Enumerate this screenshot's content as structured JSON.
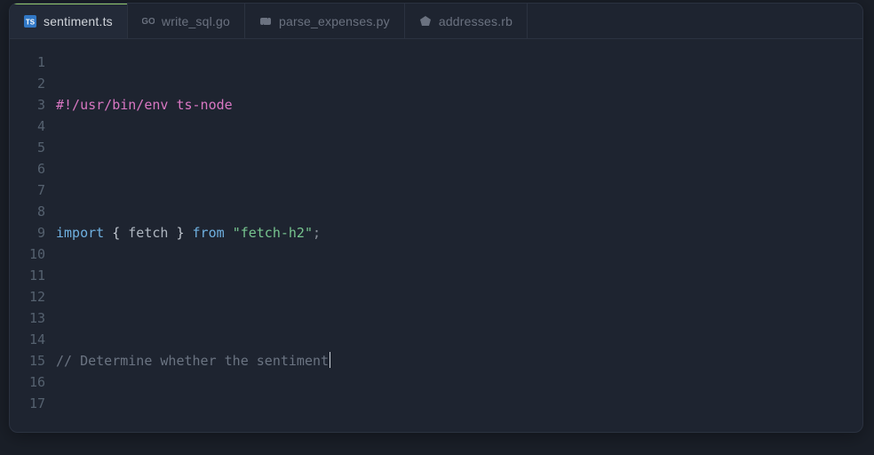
{
  "tabs": [
    {
      "label": "sentiment.ts",
      "icon": "ts-icon",
      "active": true
    },
    {
      "label": "write_sql.go",
      "icon": "go-icon",
      "active": false
    },
    {
      "label": "parse_expenses.py",
      "icon": "py-icon",
      "active": false
    },
    {
      "label": "addresses.rb",
      "icon": "rb-icon",
      "active": false
    }
  ],
  "gutter": {
    "start": 1,
    "end": 17
  },
  "code": {
    "line1": {
      "shebang": "#!/usr/bin/env ts-node"
    },
    "line3": {
      "kw_import": "import",
      "brace_l": " { ",
      "ident": "fetch",
      "brace_r": " } ",
      "kw_from": "from",
      "sp": " ",
      "str": "\"fetch-h2\"",
      "semi": ";"
    },
    "line5": {
      "comment": "// Determine whether the sentiment"
    }
  }
}
